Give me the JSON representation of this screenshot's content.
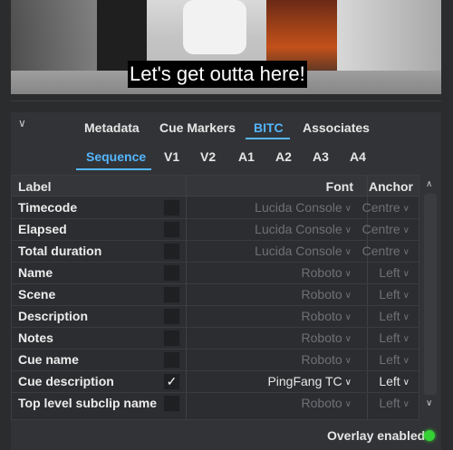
{
  "preview": {
    "subtitle": "Let's get outta here!"
  },
  "tabs": [
    {
      "label": "Metadata"
    },
    {
      "label": "Cue Markers"
    },
    {
      "label": "BITC"
    },
    {
      "label": "Associates"
    }
  ],
  "active_tab": "BITC",
  "subtabs": [
    {
      "label": "Sequence"
    },
    {
      "label": "V1"
    },
    {
      "label": "V2"
    },
    {
      "label": "A1"
    },
    {
      "label": "A2"
    },
    {
      "label": "A3"
    },
    {
      "label": "A4"
    }
  ],
  "active_subtab": "Sequence",
  "table": {
    "headers": {
      "label": "Label",
      "font": "Font",
      "anchor": "Anchor"
    },
    "rows": [
      {
        "label": "Timecode",
        "checked": "",
        "font": "Lucida Console",
        "anchor": "Centre"
      },
      {
        "label": "Elapsed",
        "checked": "",
        "font": "Lucida Console",
        "anchor": "Centre"
      },
      {
        "label": "Total duration",
        "checked": "",
        "font": "Lucida Console",
        "anchor": "Centre"
      },
      {
        "label": "Name",
        "checked": "",
        "font": "Roboto",
        "anchor": "Left"
      },
      {
        "label": "Scene",
        "checked": "",
        "font": "Roboto",
        "anchor": "Left"
      },
      {
        "label": "Description",
        "checked": "",
        "font": "Roboto",
        "anchor": "Left"
      },
      {
        "label": "Notes",
        "checked": "",
        "font": "Roboto",
        "anchor": "Left"
      },
      {
        "label": "Cue name",
        "checked": "",
        "font": "Roboto",
        "anchor": "Left"
      },
      {
        "label": "Cue description",
        "checked": "✓",
        "font": "PingFang TC",
        "anchor": "Left"
      },
      {
        "label": "Top level subclip name",
        "checked": "",
        "font": "Roboto",
        "anchor": "Left"
      }
    ]
  },
  "footer": {
    "overlay_label": "Overlay enabled"
  },
  "colors": {
    "accent": "#54b6ff",
    "status_on": "#35d235"
  },
  "icons": {
    "collapse": "chevron-down-icon",
    "dropdown": "chevron-down-icon",
    "scroll_up": "chevron-up-icon",
    "scroll_down": "chevron-down-icon"
  }
}
